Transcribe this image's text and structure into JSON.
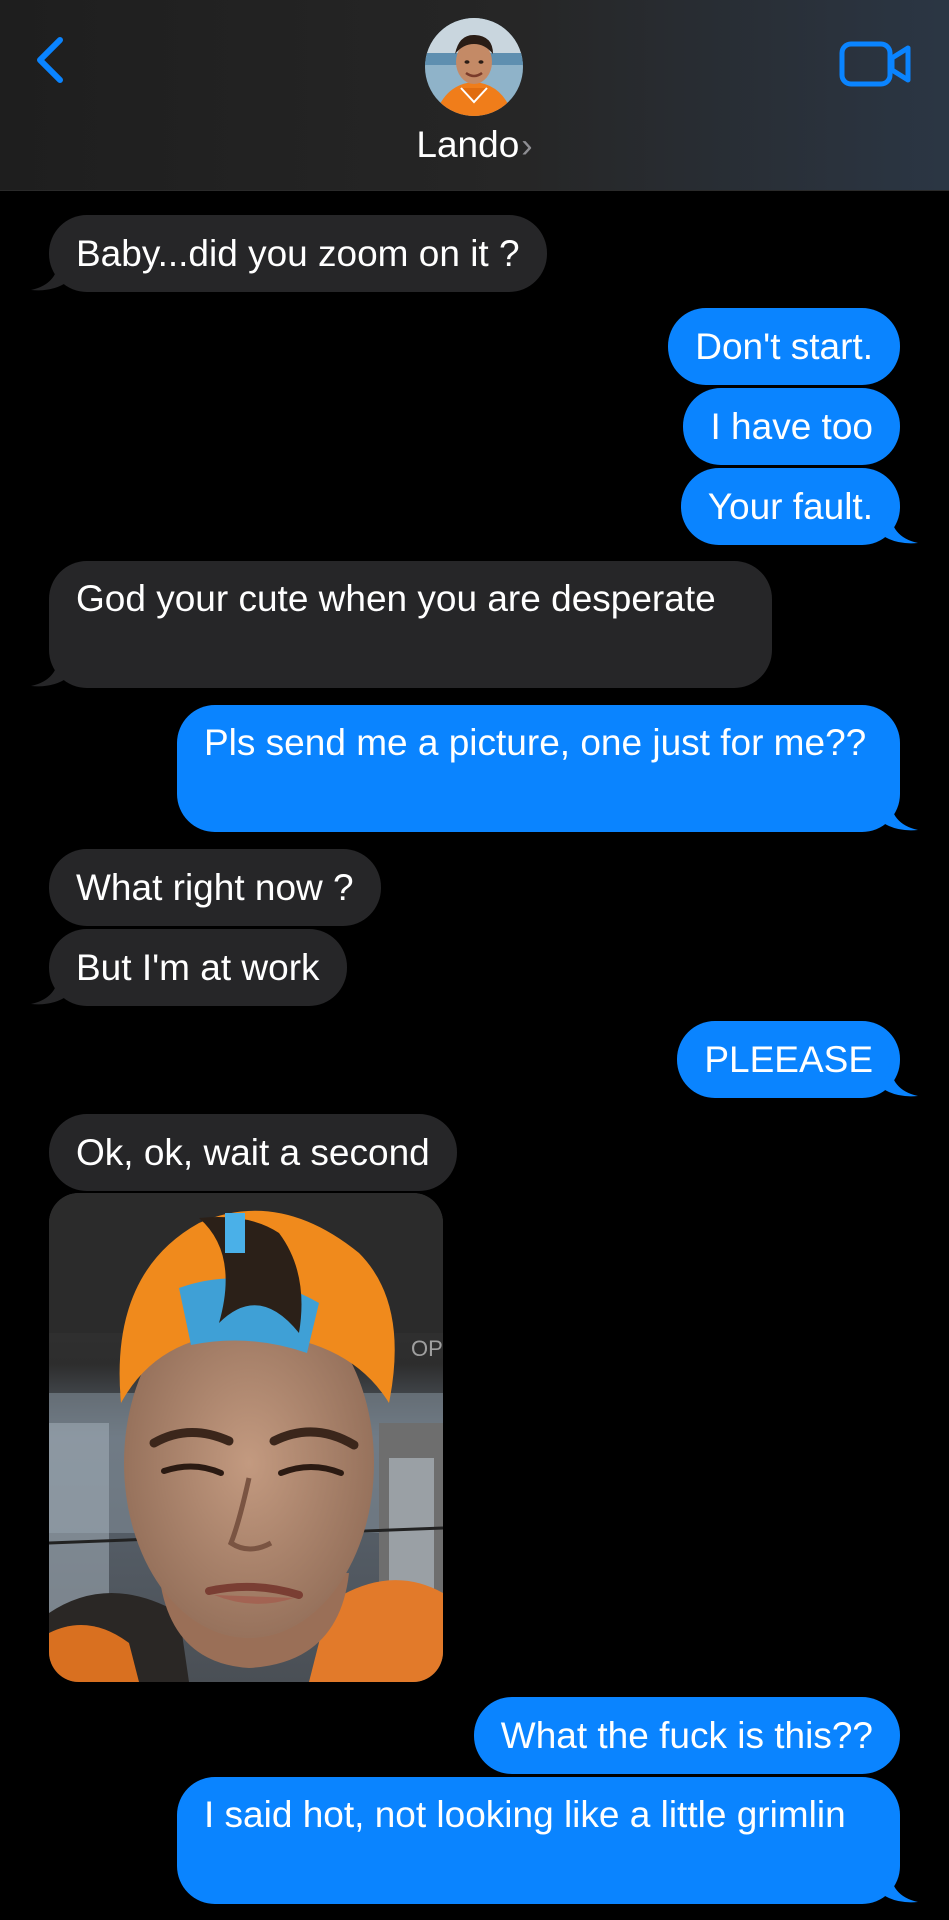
{
  "header": {
    "contact_name": "Lando",
    "chevron": "›",
    "back_icon": "chevron-left-icon",
    "video_icon": "video-camera-icon",
    "accent_color": "#0a84ff"
  },
  "messages": [
    {
      "direction": "incoming",
      "text": "Baby...did you zoom on it ?"
    },
    {
      "direction": "outgoing",
      "text": "Don't start."
    },
    {
      "direction": "outgoing",
      "text": "I have too"
    },
    {
      "direction": "outgoing",
      "text": "Your fault."
    },
    {
      "direction": "incoming",
      "text": "God your cute when you are desperate"
    },
    {
      "direction": "outgoing",
      "text": "Pls send me a picture, one just for me??"
    },
    {
      "direction": "incoming",
      "text": "What right now ?"
    },
    {
      "direction": "incoming",
      "text": "But I'm at work"
    },
    {
      "direction": "outgoing",
      "text": "PLEEASE"
    },
    {
      "direction": "incoming",
      "text": "Ok, ok, wait a second"
    },
    {
      "direction": "incoming",
      "type": "photo",
      "photo_sign_text": "OP"
    },
    {
      "direction": "outgoing",
      "text": "What the fuck is this??"
    },
    {
      "direction": "outgoing",
      "text": "I said hot, not looking like a little grimlin"
    }
  ],
  "colors": {
    "incoming_bubble": "#262628",
    "outgoing_bubble": "#0a84ff",
    "background": "#000000"
  }
}
